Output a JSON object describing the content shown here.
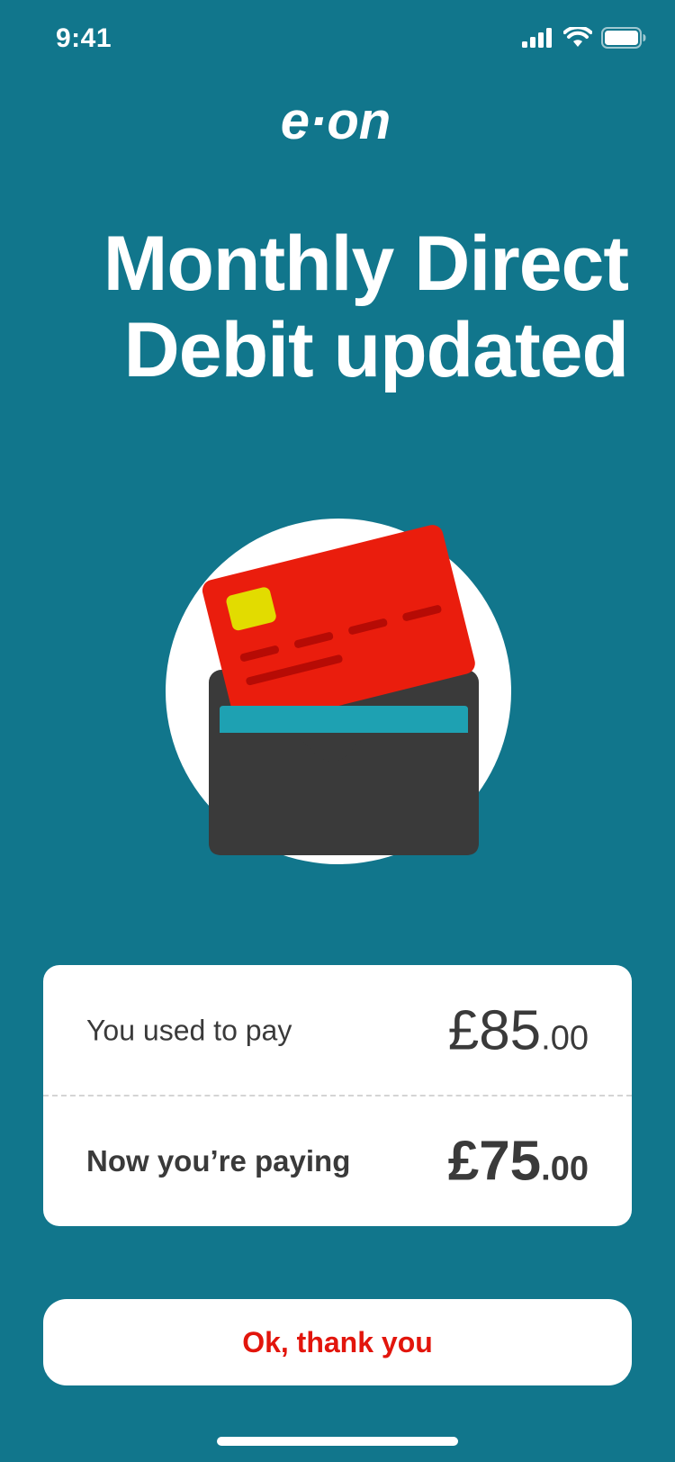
{
  "status_bar": {
    "time": "9:41"
  },
  "brand": {
    "logo_text": "e·on"
  },
  "title": "Monthly Direct Debit updated",
  "comparison": {
    "old": {
      "label": "You used to pay",
      "currency": "£",
      "whole": "85",
      "pence": ".00"
    },
    "new": {
      "label": "Now you’re paying",
      "currency": "£",
      "whole": "75",
      "pence": ".00"
    }
  },
  "button": {
    "label": "Ok, thank you"
  },
  "colors": {
    "background": "#11768c",
    "accent_red": "#e2150c",
    "card_red": "#ea1d0d",
    "wallet": "#3a3a3a",
    "chip": "#e2dc00",
    "inner_card": "#1ea1b2"
  },
  "icons": [
    "signal-icon",
    "wifi-icon",
    "battery-icon",
    "wallet-card-illustration"
  ]
}
